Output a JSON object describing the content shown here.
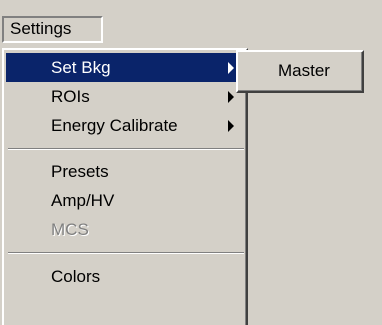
{
  "menubar": {
    "title": "Settings"
  },
  "dropdown": {
    "items": [
      {
        "label": "Set Bkg",
        "submenu": true,
        "highlighted": true,
        "enabled": true
      },
      {
        "label": "ROIs",
        "submenu": true,
        "highlighted": false,
        "enabled": true
      },
      {
        "label": "Energy Calibrate",
        "submenu": true,
        "highlighted": false,
        "enabled": true
      },
      {
        "label": "Presets",
        "submenu": false,
        "highlighted": false,
        "enabled": true
      },
      {
        "label": "Amp/HV",
        "submenu": false,
        "highlighted": false,
        "enabled": true
      },
      {
        "label": "MCS",
        "submenu": false,
        "highlighted": false,
        "enabled": false
      },
      {
        "label": "Colors",
        "submenu": false,
        "highlighted": false,
        "enabled": true
      }
    ]
  },
  "submenu": {
    "items": [
      {
        "label": "Master"
      }
    ]
  },
  "colors": {
    "highlight_bg": "#0a246a",
    "highlight_text": "#ffffff",
    "menu_bg": "#d4d0c8",
    "disabled_text": "#808080"
  }
}
